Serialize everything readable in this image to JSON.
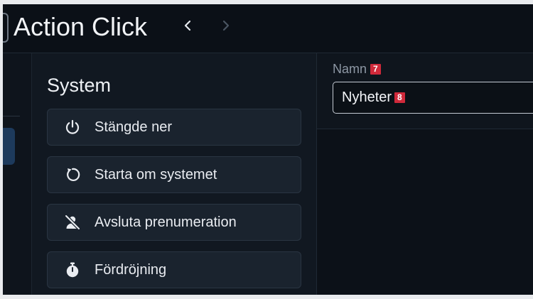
{
  "app": {
    "title": "Action Click"
  },
  "nav": {
    "back_icon": "chevron-left-icon",
    "forward_icon": "chevron-right-icon"
  },
  "system": {
    "title": "System",
    "buttons": [
      {
        "label": "Stängde ner",
        "icon": "power-icon"
      },
      {
        "label": "Starta om systemet",
        "icon": "restart-icon"
      },
      {
        "label": "Avsluta prenumeration",
        "icon": "unsubscribe-user-icon"
      },
      {
        "label": "Fördröjning",
        "icon": "stopwatch-icon"
      }
    ]
  },
  "form": {
    "name_label": "Namn",
    "name_label_badge": "7",
    "name_value": "Nyheter",
    "name_value_badge": "8"
  },
  "colors": {
    "background": "#0e141c",
    "panel": "#111821",
    "button": "#1a232e",
    "badge": "#d0293a",
    "accent_tab": "#1d3a5c"
  }
}
